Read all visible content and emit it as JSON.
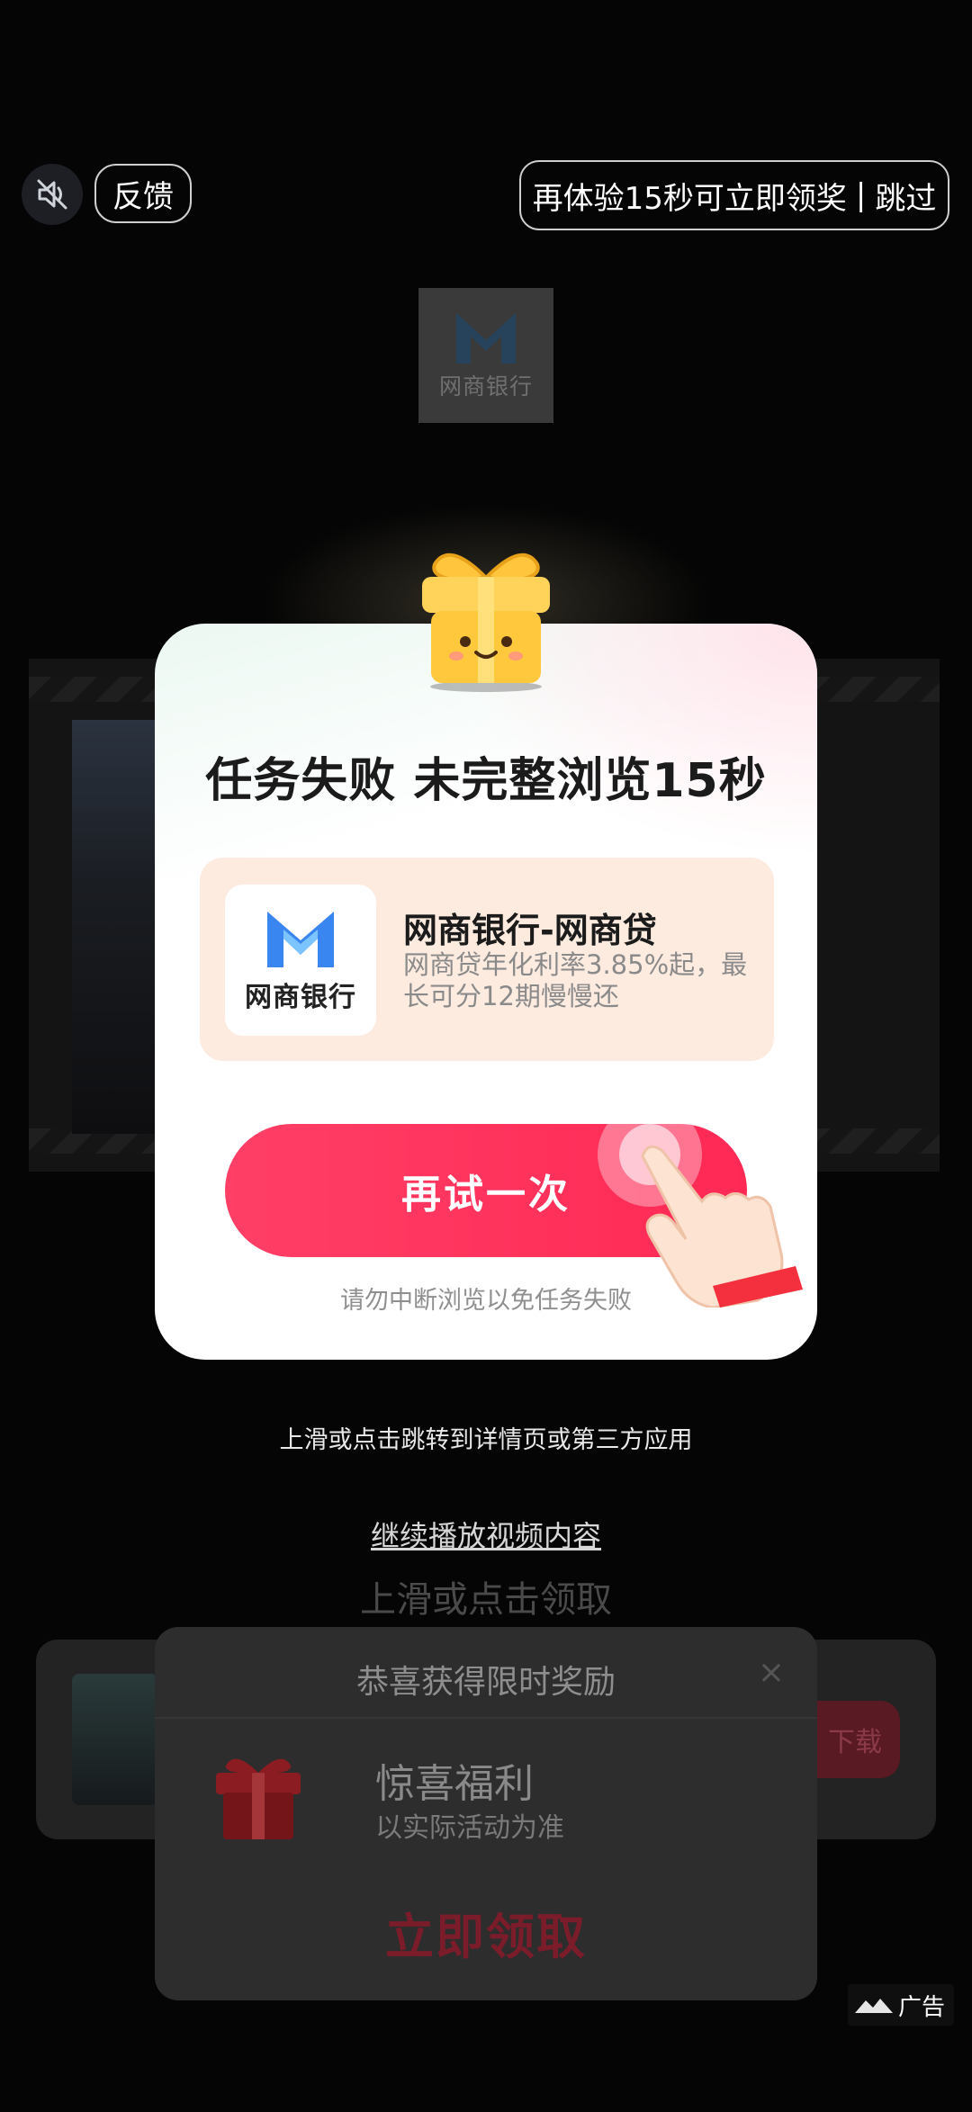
{
  "top_bar": {
    "feedback_label": "反馈",
    "skip_text": "再体验15秒可立即领奖",
    "skip_separator": "|",
    "skip_action": "跳过"
  },
  "background": {
    "brand_logo_name": "网商银行"
  },
  "modal": {
    "title": "任务失败 未完整浏览15秒",
    "app": {
      "icon_text": "网商银行",
      "name": "网商银行-网商贷",
      "description": "网商贷年化利率3.85%起，最长可分12期慢慢还"
    },
    "retry_button": "再试一次",
    "hint": "请勿中断浏览以免任务失败"
  },
  "lower": {
    "swipe_hint": "上滑或点击跳转到详情页或第三方应用",
    "continue_link": "继续播放视频内容",
    "faded_claim": "上滑或点击领取",
    "download_label": "下载"
  },
  "reward_panel": {
    "title": "恭喜获得限时奖励",
    "close_symbol": "×",
    "reward_name": "惊喜福利",
    "reward_note": "以实际活动为准",
    "claim_label": "立即领取"
  },
  "ad_tag": "广告",
  "colors": {
    "accent_red": "#ff2955",
    "brand_blue": "#3a86f0",
    "card_peach": "#fdebe0"
  },
  "icons": [
    "mute-icon",
    "gift-icon",
    "hand-pointer-icon",
    "brand-logo-icon",
    "close-icon",
    "ad-icon"
  ]
}
